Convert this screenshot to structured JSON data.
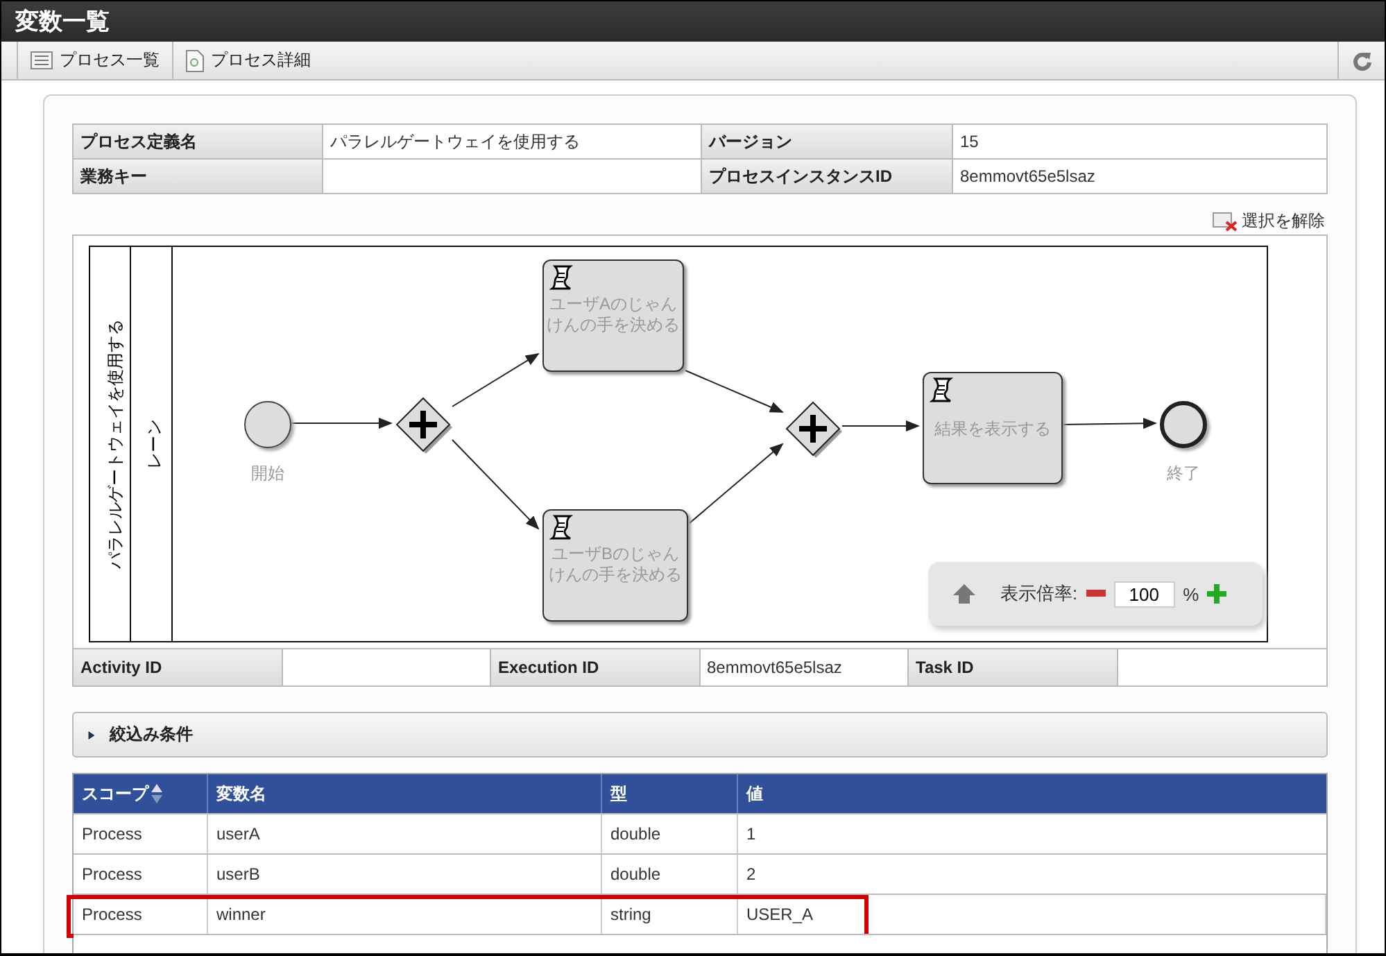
{
  "window": {
    "title": "変数一覧"
  },
  "toolbar": {
    "buttons": [
      {
        "label": "プロセス一覧",
        "kind": "list"
      },
      {
        "label": "プロセス詳細",
        "kind": "document"
      }
    ]
  },
  "info_table": {
    "rows": [
      {
        "label1": "プロセス定義名",
        "value1": "パラレルゲートウェイを使用する",
        "label2": "バージョン",
        "value2": "15"
      },
      {
        "label1": "業務キー",
        "label2": "プロセスインスタンスID",
        "value2": "8emmovt65e5lsaz"
      }
    ]
  },
  "deselect_link": "選択を解除",
  "diagram": {
    "pool": "パラレルゲートウェイを使用する",
    "lane": "レーン",
    "nodes": [
      {
        "kind": "start",
        "label": "開始"
      },
      {
        "kind": "gateway"
      },
      {
        "kind": "task",
        "label": "ユーザAのじゃんけんの手を決める"
      },
      {
        "kind": "task",
        "label": "ユーザBのじゃんけんの手を決める"
      },
      {
        "kind": "gateway"
      },
      {
        "kind": "task",
        "label": "結果を表示する"
      },
      {
        "kind": "end",
        "label": "終了"
      }
    ],
    "zoom": {
      "label": "表示倍率:",
      "value": "100",
      "unit": "%"
    }
  },
  "execution_table": [
    {
      "label": "Activity ID"
    },
    {
      "label": "Execution ID",
      "value": "8emmovt65e5lsaz"
    },
    {
      "label": "Task ID"
    }
  ],
  "filter": {
    "label": "絞込み条件",
    "expanded": false
  },
  "variables": {
    "columns": [
      "スコープ",
      "変数名",
      "型",
      "値"
    ],
    "rows": [
      {
        "cells": [
          "Process",
          "userA",
          "double",
          "1"
        ],
        "highlighted": false
      },
      {
        "cells": [
          "Process",
          "userB",
          "double",
          "2"
        ],
        "highlighted": false
      },
      {
        "cells": [
          "Process",
          "winner",
          "string",
          "USER_A"
        ],
        "highlighted": true
      }
    ]
  }
}
